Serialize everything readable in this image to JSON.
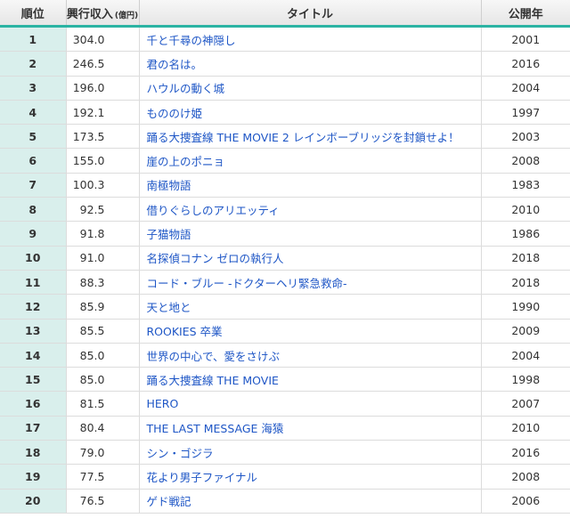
{
  "table": {
    "headers": {
      "rank": "順位",
      "gross": "興行収入",
      "gross_unit": "(億円)",
      "title": "タイトル",
      "year": "公開年"
    },
    "rows": [
      {
        "rank": "1",
        "gross": "304.0",
        "title": "千と千尋の神隠し",
        "year": "2001"
      },
      {
        "rank": "2",
        "gross": "246.5",
        "title": "君の名は。",
        "year": "2016"
      },
      {
        "rank": "3",
        "gross": "196.0",
        "title": "ハウルの動く城",
        "year": "2004"
      },
      {
        "rank": "4",
        "gross": "192.1",
        "title": "もののけ姫",
        "year": "1997"
      },
      {
        "rank": "5",
        "gross": "173.5",
        "title": "踊る大捜査線 THE MOVIE 2 レインボーブリッジを封鎖せよ！",
        "year": "2003"
      },
      {
        "rank": "6",
        "gross": "155.0",
        "title": "崖の上のポニョ",
        "year": "2008"
      },
      {
        "rank": "7",
        "gross": "100.3",
        "title": "南極物語",
        "year": "1983"
      },
      {
        "rank": "8",
        "gross": "92.5",
        "title": "借りぐらしのアリエッティ",
        "year": "2010"
      },
      {
        "rank": "9",
        "gross": "91.8",
        "title": "子猫物語",
        "year": "1986"
      },
      {
        "rank": "10",
        "gross": "91.0",
        "title": "名探偵コナン ゼロの執行人",
        "year": "2018"
      },
      {
        "rank": "11",
        "gross": "88.3",
        "title": "コード・ブルー -ドクターヘリ緊急救命-",
        "year": "2018"
      },
      {
        "rank": "12",
        "gross": "85.9",
        "title": "天と地と",
        "year": "1990"
      },
      {
        "rank": "13",
        "gross": "85.5",
        "title": "ROOKIES 卒業",
        "year": "2009"
      },
      {
        "rank": "14",
        "gross": "85.0",
        "title": "世界の中心で、愛をさけぶ",
        "year": "2004"
      },
      {
        "rank": "15",
        "gross": "85.0",
        "title": "踊る大捜査線 THE MOVIE",
        "year": "1998"
      },
      {
        "rank": "16",
        "gross": "81.5",
        "title": "HERO",
        "year": "2007"
      },
      {
        "rank": "17",
        "gross": "80.4",
        "title": "THE LAST MESSAGE 海猿",
        "year": "2010"
      },
      {
        "rank": "18",
        "gross": "79.0",
        "title": "シン・ゴジラ",
        "year": "2016"
      },
      {
        "rank": "19",
        "gross": "77.5",
        "title": "花より男子ファイナル",
        "year": "2008"
      },
      {
        "rank": "20",
        "gross": "76.5",
        "title": "ゲド戦記",
        "year": "2006"
      }
    ]
  }
}
